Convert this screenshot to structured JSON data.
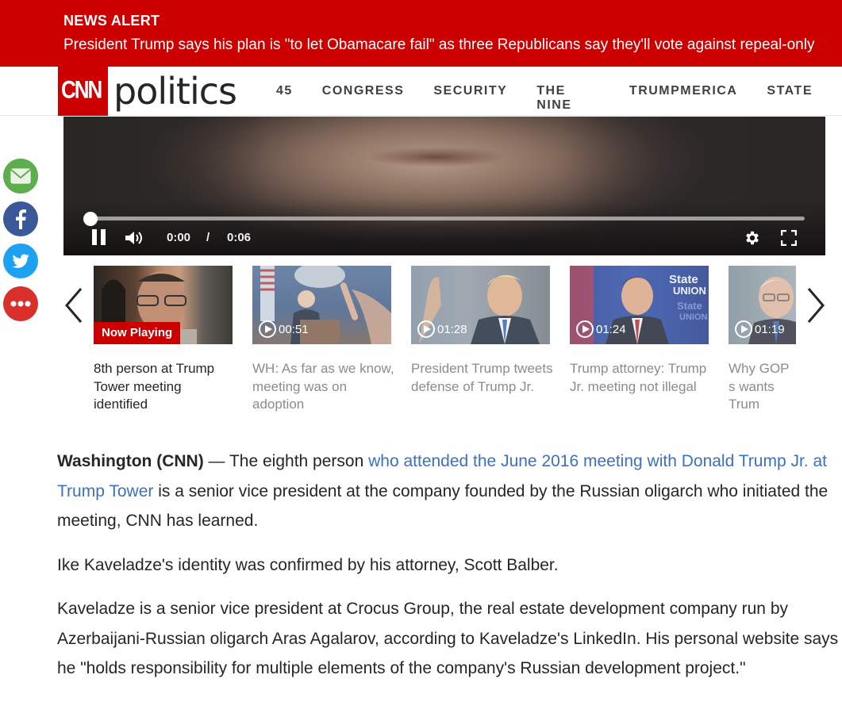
{
  "alert": {
    "label": "NEWS ALERT",
    "headline": "President Trump says his plan is \"to let Obamacare fail\" as three Republicans say they'll vote against repeal-only"
  },
  "nav": {
    "logo": "CNN",
    "section": "politics",
    "links": [
      "45",
      "CONGRESS",
      "SECURITY",
      "THE NINE",
      "TRUMPMERICA",
      "STATE"
    ]
  },
  "player": {
    "current_time": "0:00",
    "separator": "/",
    "duration": "0:06",
    "progress": 0
  },
  "share": [
    "email-icon",
    "facebook-icon",
    "twitter-icon",
    "more-icon"
  ],
  "carousel": {
    "items": [
      {
        "badge": "Now Playing",
        "caption": "8th person at Trump Tower meeting identified"
      },
      {
        "duration": "00:51",
        "caption": "WH: As far as we know, meeting was on adoption"
      },
      {
        "duration": "01:28",
        "caption": "President Trump tweets defense of Trump Jr."
      },
      {
        "duration": "01:24",
        "caption": "Trump attorney: Trump Jr. meeting not illegal"
      },
      {
        "duration": "01:19",
        "caption": "Why GOP s wants Trum testify"
      }
    ]
  },
  "article": {
    "dateline": "Washington (CNN)",
    "dash": " — ",
    "p1_before": "The eighth person ",
    "p1_link": "who attended the June 2016 meeting with Donald Trump Jr. at Trump Tower",
    "p1_after": " is a senior vice president at the company founded by the Russian oligarch who initiated the meeting, CNN has learned.",
    "p2": "Ike Kaveladze's identity was confirmed by his attorney, Scott Balber.",
    "p3": "Kaveladze is a senior vice president at Crocus Group, the real estate development company run by Azerbaijani-Russian oligarch Aras Agalarov, according to Kaveladze's LinkedIn. His personal website says he \"holds responsibility for multiple elements of the company's Russian development project.\""
  },
  "colors": {
    "brand_red": "#cc0000",
    "link_blue": "#3b70c4"
  }
}
